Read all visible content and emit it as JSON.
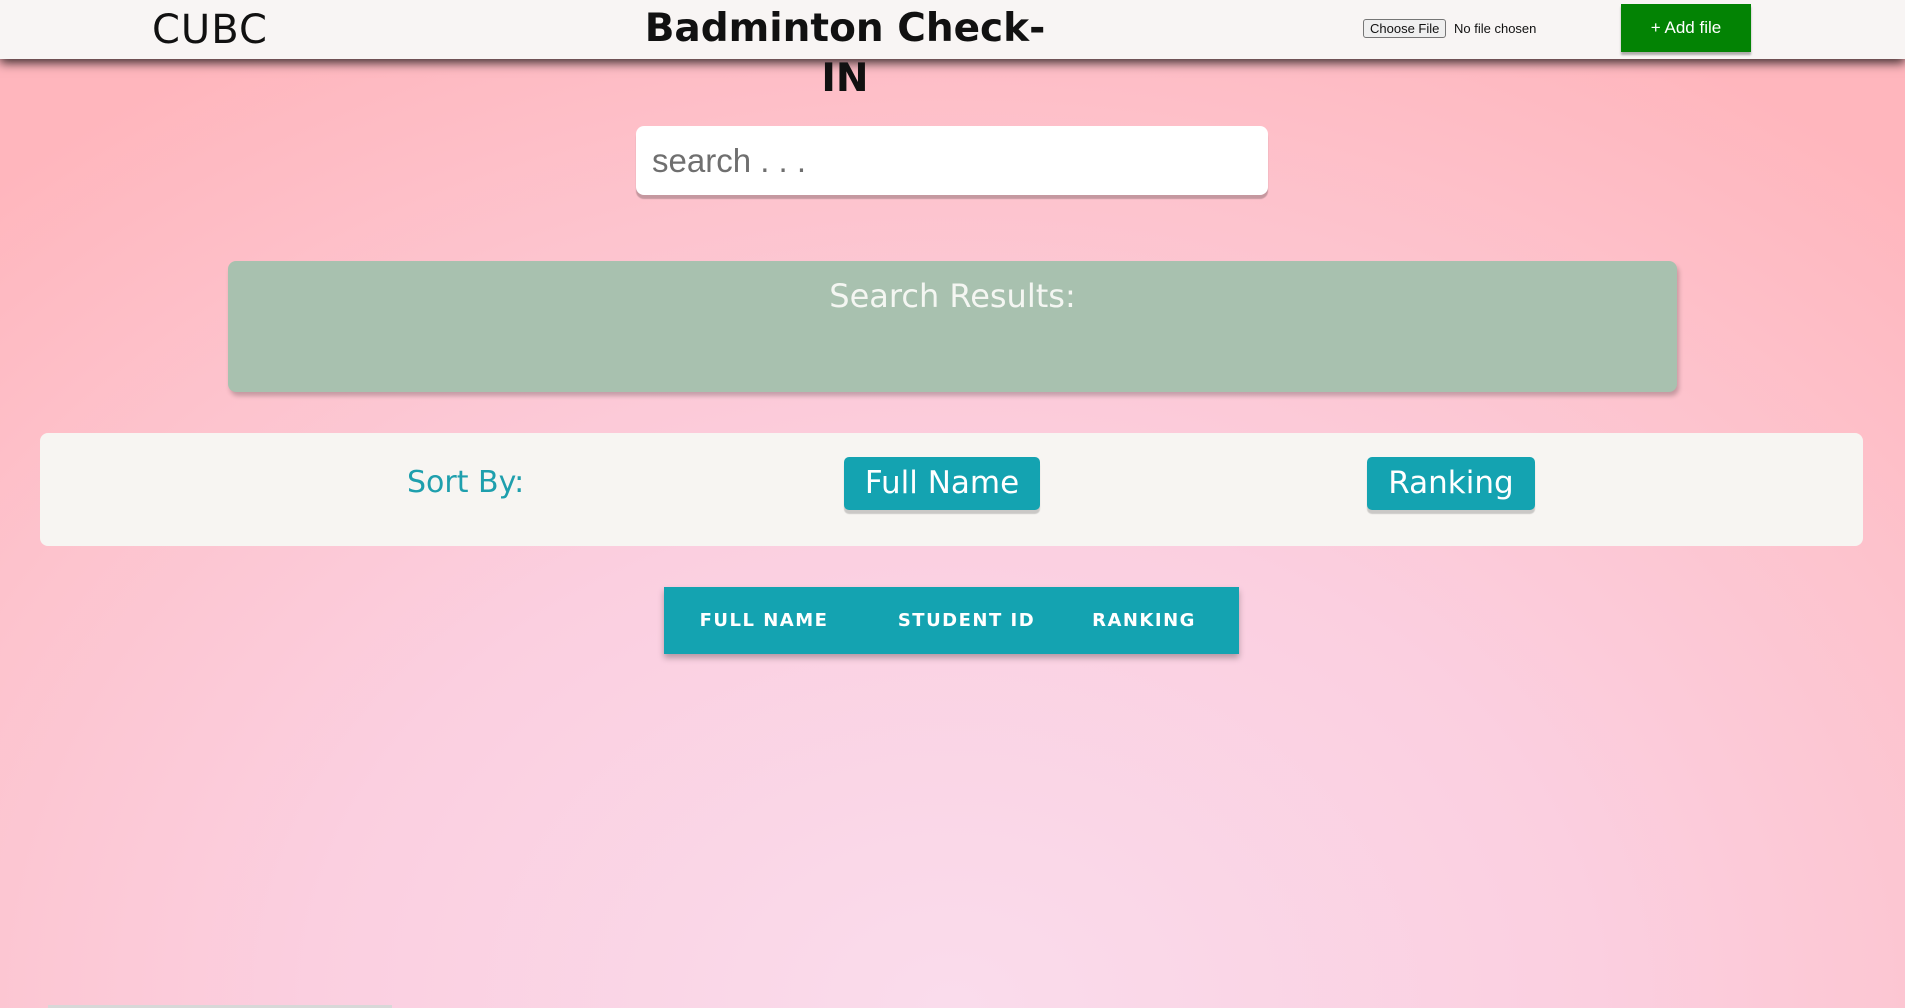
{
  "header": {
    "brand": "CUBC",
    "title": "Badminton Check-IN",
    "file_input": {
      "button_label": "Choose File",
      "status": "No file chosen"
    },
    "add_file_label": "+ Add file"
  },
  "search": {
    "placeholder": "search . . .",
    "value": ""
  },
  "results": {
    "title": "Search Results:",
    "items": []
  },
  "sort": {
    "label": "Sort By:",
    "options": [
      "Full Name",
      "Ranking"
    ]
  },
  "table": {
    "columns": [
      "FULL NAME",
      "STUDENT ID",
      "RANKING"
    ],
    "rows": []
  },
  "colors": {
    "accent": "#14a3b1",
    "add_button": "#038304",
    "results_panel": "#a8c1af",
    "panel_background": "#f7f5f2"
  }
}
